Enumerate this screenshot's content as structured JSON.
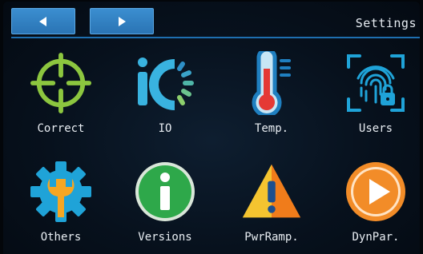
{
  "header": {
    "title": "Settings"
  },
  "nav": {
    "back_icon": "left-arrow-icon",
    "forward_icon": "right-arrow-icon"
  },
  "tiles": [
    {
      "label": "Correct",
      "icon": "crosshair-icon"
    },
    {
      "label": "IO",
      "icon": "io-icon"
    },
    {
      "label": "Temp.",
      "icon": "thermometer-icon"
    },
    {
      "label": "Users",
      "icon": "fingerprint-icon"
    },
    {
      "label": "Others",
      "icon": "gear-wrench-icon"
    },
    {
      "label": "Versions",
      "icon": "info-icon"
    },
    {
      "label": "PwrRamp.",
      "icon": "warning-icon"
    },
    {
      "label": "DynPar.",
      "icon": "play-icon"
    }
  ],
  "colors": {
    "accent": "#2a74b4",
    "background": "#07111d",
    "text": "#e9eef3",
    "crosshair": "#8cc63f",
    "io_blue": "#39b3e0",
    "thermo_red": "#e53935",
    "gear_blue": "#1fa3d8",
    "wrench_orange": "#f5a623",
    "info_green": "#2ea84a",
    "warning_yellow": "#f4c430",
    "warning_orange": "#f07c1b",
    "play_orange": "#f28c28"
  }
}
